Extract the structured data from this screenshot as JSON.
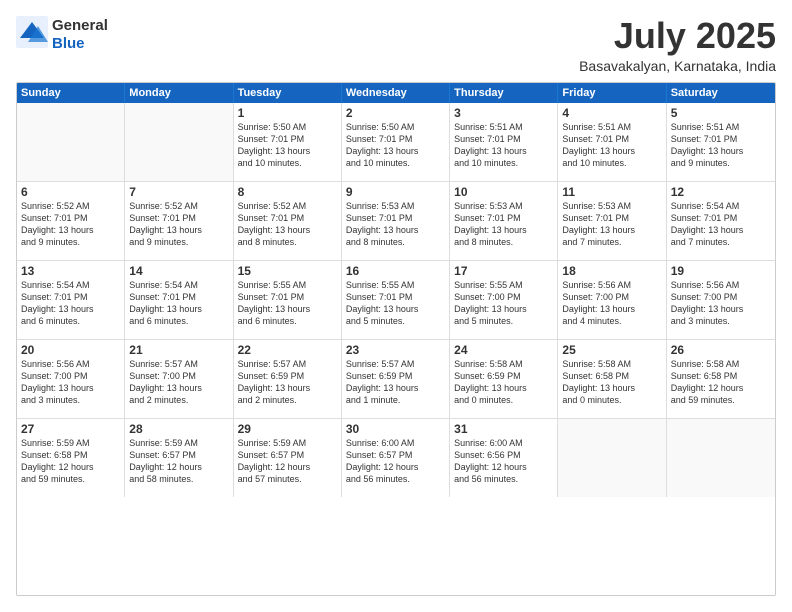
{
  "logo": {
    "general": "General",
    "blue": "Blue"
  },
  "title": "July 2025",
  "location": "Basavakalyan, Karnataka, India",
  "days_of_week": [
    "Sunday",
    "Monday",
    "Tuesday",
    "Wednesday",
    "Thursday",
    "Friday",
    "Saturday"
  ],
  "weeks": [
    [
      {
        "day": "",
        "info": ""
      },
      {
        "day": "",
        "info": ""
      },
      {
        "day": "1",
        "info": "Sunrise: 5:50 AM\nSunset: 7:01 PM\nDaylight: 13 hours\nand 10 minutes."
      },
      {
        "day": "2",
        "info": "Sunrise: 5:50 AM\nSunset: 7:01 PM\nDaylight: 13 hours\nand 10 minutes."
      },
      {
        "day": "3",
        "info": "Sunrise: 5:51 AM\nSunset: 7:01 PM\nDaylight: 13 hours\nand 10 minutes."
      },
      {
        "day": "4",
        "info": "Sunrise: 5:51 AM\nSunset: 7:01 PM\nDaylight: 13 hours\nand 10 minutes."
      },
      {
        "day": "5",
        "info": "Sunrise: 5:51 AM\nSunset: 7:01 PM\nDaylight: 13 hours\nand 9 minutes."
      }
    ],
    [
      {
        "day": "6",
        "info": "Sunrise: 5:52 AM\nSunset: 7:01 PM\nDaylight: 13 hours\nand 9 minutes."
      },
      {
        "day": "7",
        "info": "Sunrise: 5:52 AM\nSunset: 7:01 PM\nDaylight: 13 hours\nand 9 minutes."
      },
      {
        "day": "8",
        "info": "Sunrise: 5:52 AM\nSunset: 7:01 PM\nDaylight: 13 hours\nand 8 minutes."
      },
      {
        "day": "9",
        "info": "Sunrise: 5:53 AM\nSunset: 7:01 PM\nDaylight: 13 hours\nand 8 minutes."
      },
      {
        "day": "10",
        "info": "Sunrise: 5:53 AM\nSunset: 7:01 PM\nDaylight: 13 hours\nand 8 minutes."
      },
      {
        "day": "11",
        "info": "Sunrise: 5:53 AM\nSunset: 7:01 PM\nDaylight: 13 hours\nand 7 minutes."
      },
      {
        "day": "12",
        "info": "Sunrise: 5:54 AM\nSunset: 7:01 PM\nDaylight: 13 hours\nand 7 minutes."
      }
    ],
    [
      {
        "day": "13",
        "info": "Sunrise: 5:54 AM\nSunset: 7:01 PM\nDaylight: 13 hours\nand 6 minutes."
      },
      {
        "day": "14",
        "info": "Sunrise: 5:54 AM\nSunset: 7:01 PM\nDaylight: 13 hours\nand 6 minutes."
      },
      {
        "day": "15",
        "info": "Sunrise: 5:55 AM\nSunset: 7:01 PM\nDaylight: 13 hours\nand 6 minutes."
      },
      {
        "day": "16",
        "info": "Sunrise: 5:55 AM\nSunset: 7:01 PM\nDaylight: 13 hours\nand 5 minutes."
      },
      {
        "day": "17",
        "info": "Sunrise: 5:55 AM\nSunset: 7:00 PM\nDaylight: 13 hours\nand 5 minutes."
      },
      {
        "day": "18",
        "info": "Sunrise: 5:56 AM\nSunset: 7:00 PM\nDaylight: 13 hours\nand 4 minutes."
      },
      {
        "day": "19",
        "info": "Sunrise: 5:56 AM\nSunset: 7:00 PM\nDaylight: 13 hours\nand 3 minutes."
      }
    ],
    [
      {
        "day": "20",
        "info": "Sunrise: 5:56 AM\nSunset: 7:00 PM\nDaylight: 13 hours\nand 3 minutes."
      },
      {
        "day": "21",
        "info": "Sunrise: 5:57 AM\nSunset: 7:00 PM\nDaylight: 13 hours\nand 2 minutes."
      },
      {
        "day": "22",
        "info": "Sunrise: 5:57 AM\nSunset: 6:59 PM\nDaylight: 13 hours\nand 2 minutes."
      },
      {
        "day": "23",
        "info": "Sunrise: 5:57 AM\nSunset: 6:59 PM\nDaylight: 13 hours\nand 1 minute."
      },
      {
        "day": "24",
        "info": "Sunrise: 5:58 AM\nSunset: 6:59 PM\nDaylight: 13 hours\nand 0 minutes."
      },
      {
        "day": "25",
        "info": "Sunrise: 5:58 AM\nSunset: 6:58 PM\nDaylight: 13 hours\nand 0 minutes."
      },
      {
        "day": "26",
        "info": "Sunrise: 5:58 AM\nSunset: 6:58 PM\nDaylight: 12 hours\nand 59 minutes."
      }
    ],
    [
      {
        "day": "27",
        "info": "Sunrise: 5:59 AM\nSunset: 6:58 PM\nDaylight: 12 hours\nand 59 minutes."
      },
      {
        "day": "28",
        "info": "Sunrise: 5:59 AM\nSunset: 6:57 PM\nDaylight: 12 hours\nand 58 minutes."
      },
      {
        "day": "29",
        "info": "Sunrise: 5:59 AM\nSunset: 6:57 PM\nDaylight: 12 hours\nand 57 minutes."
      },
      {
        "day": "30",
        "info": "Sunrise: 6:00 AM\nSunset: 6:57 PM\nDaylight: 12 hours\nand 56 minutes."
      },
      {
        "day": "31",
        "info": "Sunrise: 6:00 AM\nSunset: 6:56 PM\nDaylight: 12 hours\nand 56 minutes."
      },
      {
        "day": "",
        "info": ""
      },
      {
        "day": "",
        "info": ""
      }
    ]
  ]
}
